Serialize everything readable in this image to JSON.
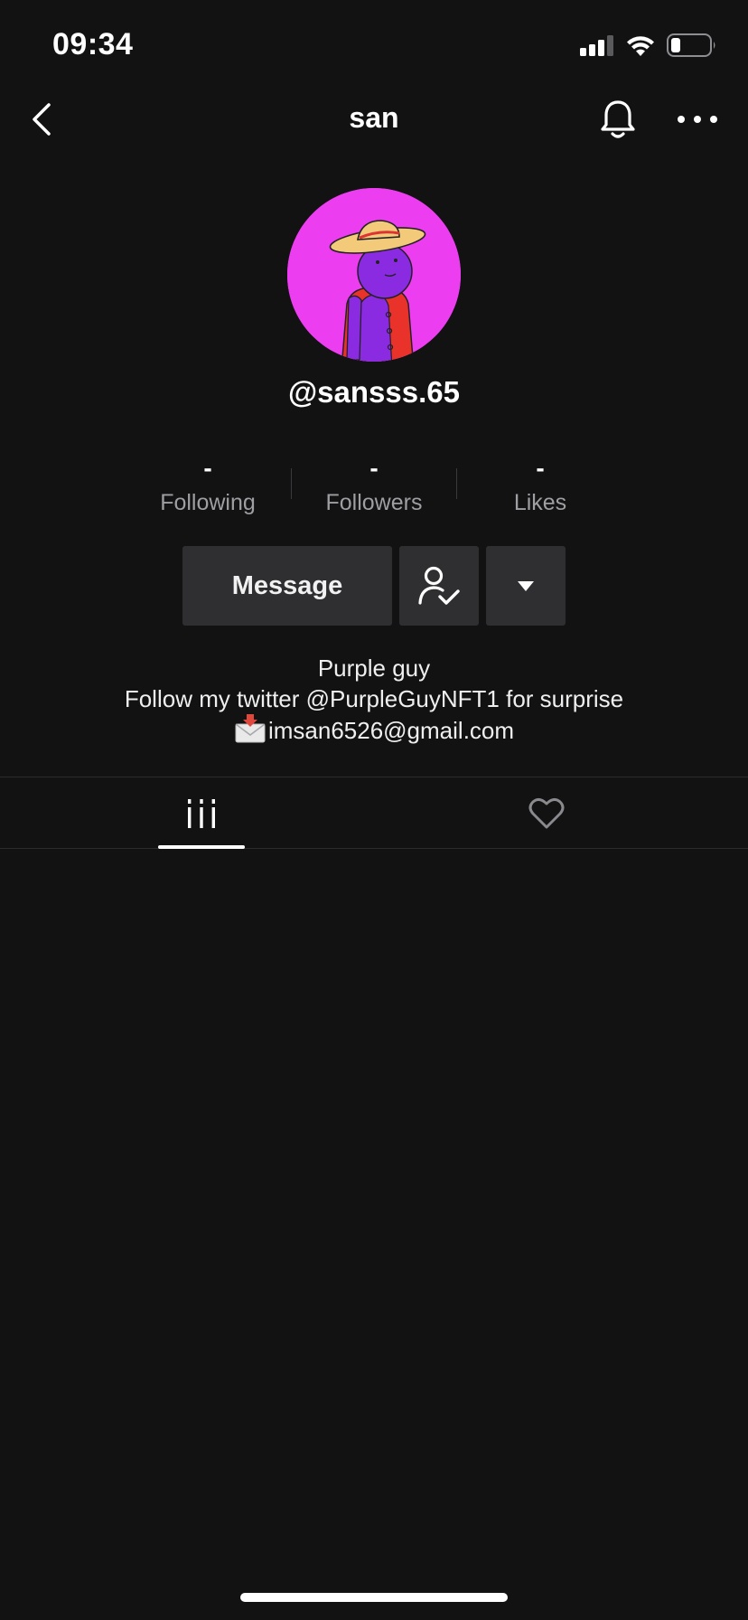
{
  "status_bar": {
    "time": "09:34",
    "icons": [
      "signal-icon",
      "wifi-icon",
      "battery-icon"
    ],
    "battery_level": 0.25
  },
  "nav": {
    "title": "san",
    "back_icon": "chevron-left-icon",
    "bell_icon": "bell-icon",
    "more_icon": "more-horizontal-icon"
  },
  "profile": {
    "handle": "@sansss.65",
    "avatar_background": "#ec3ef0"
  },
  "stats": [
    {
      "value": "-",
      "label": "Following"
    },
    {
      "value": "-",
      "label": "Followers"
    },
    {
      "value": "-",
      "label": "Likes"
    }
  ],
  "actions": {
    "message_label": "Message",
    "following_icon": "user-check-icon",
    "dropdown_icon": "caret-down-icon"
  },
  "bio": {
    "line1": "Purple guy",
    "line2": "Follow my twitter @PurpleGuyNFT1 for surprise",
    "email": "imsan6526@gmail.com",
    "email_icon": "envelope-arrow-icon"
  },
  "tabs": [
    {
      "icon": "grid-icon",
      "active": true
    },
    {
      "icon": "heart-outline-icon",
      "active": false
    }
  ],
  "colors": {
    "background": "#121213",
    "button": "#2f2f31",
    "muted_text": "#9e9ea3"
  }
}
